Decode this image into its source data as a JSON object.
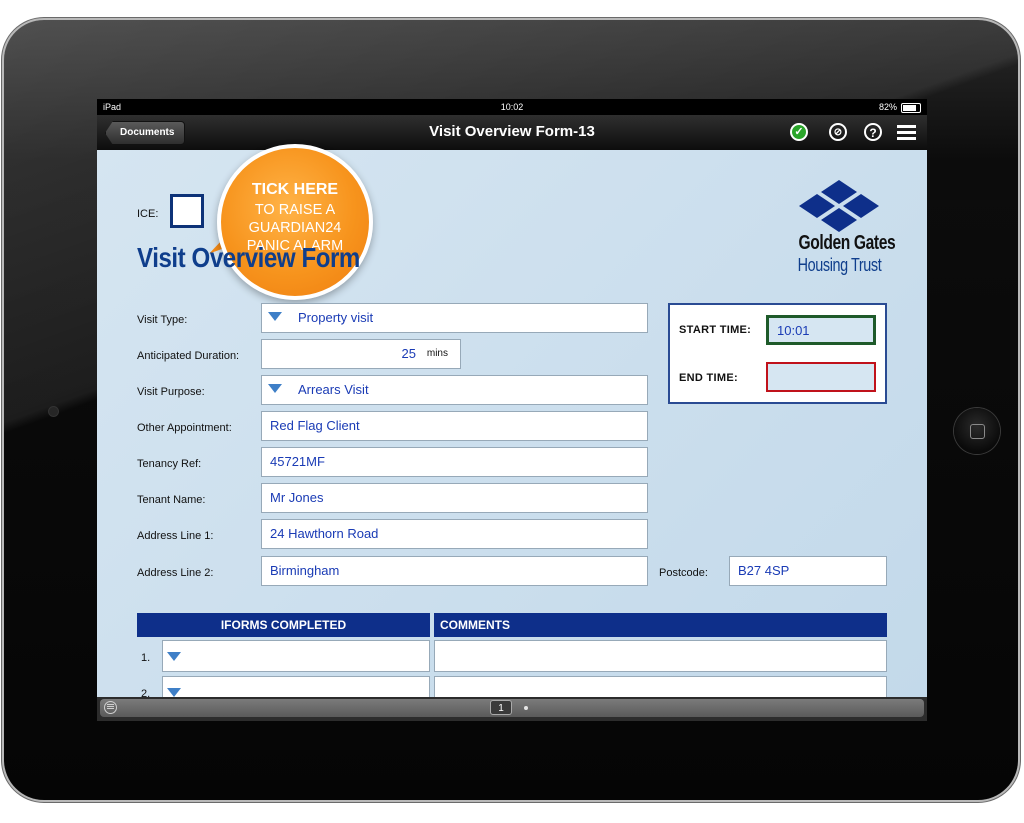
{
  "status_bar": {
    "device": "iPad",
    "time": "10:02",
    "battery": "82%"
  },
  "nav": {
    "back_label": "Documents",
    "title": "Visit Overview Form-13"
  },
  "callout": {
    "line1": "TICK HERE",
    "line2": "TO RAISE A",
    "line3": "GUARDIAN24",
    "line4": "PANIC ALARM"
  },
  "form": {
    "ice_label": "ICE:",
    "title": "Visit Overview Form",
    "logo": {
      "line1": "Golden Gates",
      "line2": "Housing Trust"
    },
    "fields": {
      "visit_type": {
        "label": "Visit Type:",
        "value": "Property visit"
      },
      "duration": {
        "label": "Anticipated Duration:",
        "value": "25",
        "unit": "mins"
      },
      "visit_purpose": {
        "label": "Visit Purpose:",
        "value": "Arrears Visit"
      },
      "other_appointment": {
        "label": "Other Appointment:",
        "value": "Red Flag Client"
      },
      "tenancy_ref": {
        "label": "Tenancy Ref:",
        "value": "45721MF"
      },
      "tenant_name": {
        "label": "Tenant Name:",
        "value": "Mr Jones"
      },
      "address1": {
        "label": "Address Line 1:",
        "value": "24 Hawthorn Road"
      },
      "address2": {
        "label": "Address Line 2:",
        "value": "Birmingham"
      },
      "postcode": {
        "label": "Postcode:",
        "value": "B27 4SP"
      }
    },
    "times": {
      "start_label": "START TIME:",
      "start_value": "10:01",
      "end_label": "END TIME:",
      "end_value": ""
    },
    "table": {
      "col1": "IFORMS COMPLETED",
      "col2": "COMMENTS",
      "rows": [
        {
          "num": "1."
        },
        {
          "num": "2."
        }
      ]
    }
  },
  "toolbar": {
    "page": "1"
  },
  "colors": {
    "accent": "#0f3e8c",
    "field_text": "#1a3bb5",
    "callout": "#f7941d",
    "start_border": "#1e5a2a",
    "end_border": "#c0121b"
  }
}
